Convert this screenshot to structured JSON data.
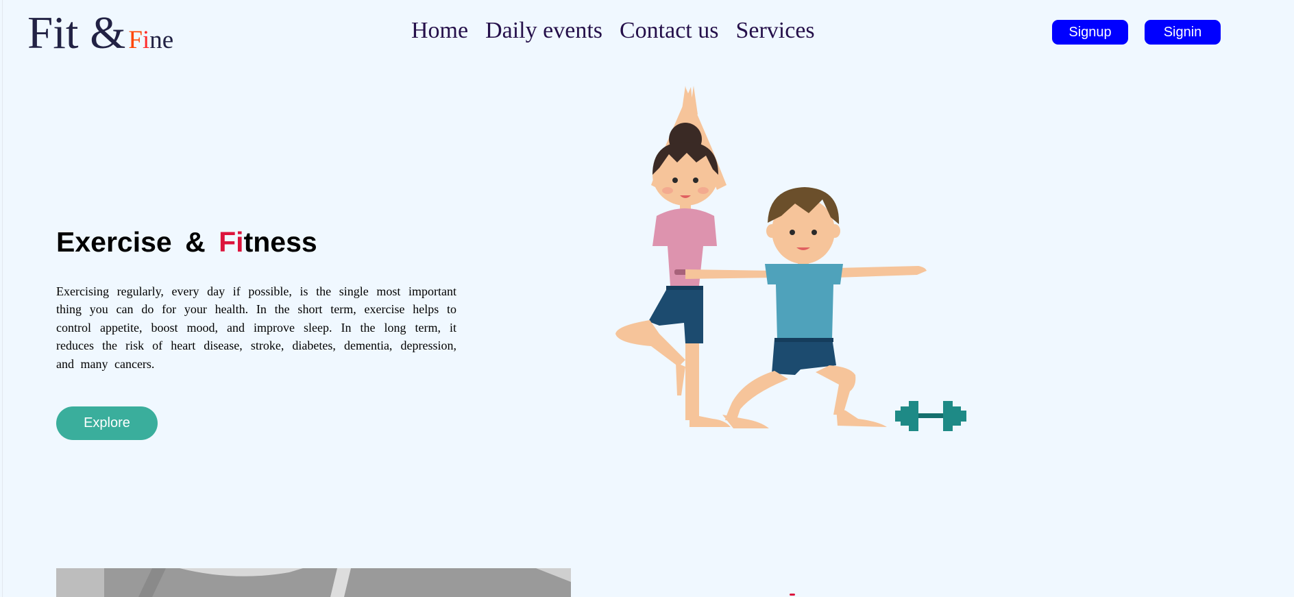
{
  "logo": {
    "main": "Fit &",
    "sub_f": "F",
    "sub_i": "i",
    "sub_rest": "ne"
  },
  "nav": {
    "items": [
      "Home",
      "Daily events",
      "Contact us",
      "Services"
    ]
  },
  "auth": {
    "signup": "Signup",
    "signin": "Signin"
  },
  "hero": {
    "title_prefix": "Exercise & ",
    "title_F": "F",
    "title_i": "i",
    "title_rest": "tness",
    "paragraph": "Exercising regularly, every day if possible, is the single most important thing you can do for your health. In the short term, exercise helps to control appetite, boost mood, and improve sleep. In the long term, it reduces the risk of heart disease, stroke, diabetes, dementia, depression, and many cancers.",
    "cta": "Explore"
  },
  "colors": {
    "background": "#f0f8ff",
    "accent_blue": "#0000ff",
    "accent_teal": "#3aae9c",
    "accent_red": "#dc143c",
    "logo_orange": "#ff4500"
  }
}
